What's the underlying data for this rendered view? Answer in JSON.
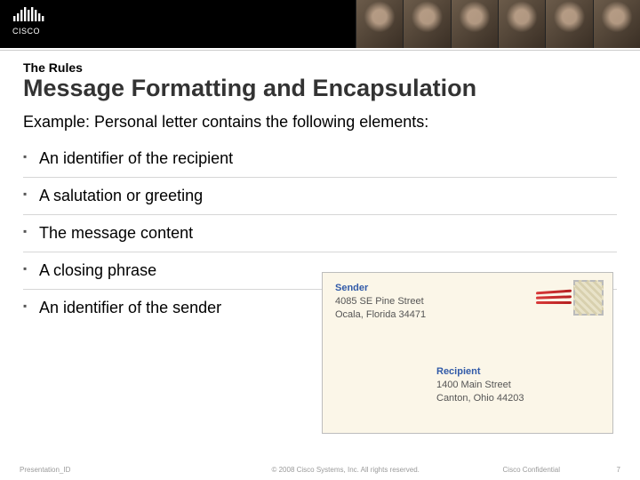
{
  "brand": {
    "name": "CISCO"
  },
  "kicker": "The Rules",
  "title": "Message Formatting and Encapsulation",
  "subtitle": "Example: Personal letter contains the following elements:",
  "bullets": [
    "An identifier of the recipient",
    "A salutation or greeting",
    "The message content",
    "A closing phrase",
    "An identifier of the sender"
  ],
  "envelope": {
    "sender": {
      "label": "Sender",
      "line1": "4085 SE Pine Street",
      "line2": "Ocala, Florida 34471"
    },
    "recipient": {
      "label": "Recipient",
      "line1": "1400 Main Street",
      "line2": "Canton, Ohio 44203"
    }
  },
  "footer": {
    "id": "Presentation_ID",
    "copyright": "© 2008 Cisco Systems, Inc. All rights reserved.",
    "confidential": "Cisco Confidential",
    "page": "7"
  }
}
